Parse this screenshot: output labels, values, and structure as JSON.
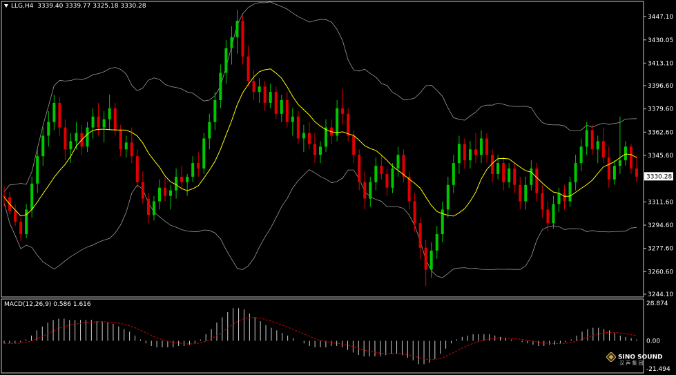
{
  "header": {
    "symbol": "LLG,H4",
    "ohlc": "3339.40 3339.77 3325.18 3330.28"
  },
  "macd_header": {
    "label": "MACD(12,26,9)",
    "values": "0.586 1.616"
  },
  "logo": {
    "name": "SINO SOUND",
    "sub": "汉 声 集 团"
  },
  "colors": {
    "background": "#000000",
    "bull": "#00c800",
    "bear": "#e00000",
    "ma": "#ffff00",
    "bands": "#9a9a9a",
    "macd_hist": "#d0d0d0",
    "macd_signal": "#e00000",
    "axis_text": "#ffffff",
    "price_label_bg": "#ffffff"
  },
  "chart_data": {
    "type": "candlestick",
    "price_axis": {
      "ticks": [
        "3447.10",
        "3430.05",
        "3413.10",
        "3396.60",
        "3379.60",
        "3362.60",
        "3345.60",
        "3330.28",
        "3311.60",
        "3294.60",
        "3277.60",
        "3260.60",
        "3244.10"
      ],
      "ylim": [
        3244.1,
        3447.1
      ],
      "current_price": "3330.28"
    },
    "macd_axis": {
      "ticks": [
        "28.874",
        "0.00",
        "-21.494"
      ],
      "ylim": [
        -21.494,
        28.874
      ]
    },
    "indicators": [
      "Moving Average",
      "Bollinger Bands",
      "MACD(12,26,9)"
    ],
    "candles": [
      [
        3316,
        3323,
        3308,
        3315
      ],
      [
        3315,
        3319,
        3302,
        3305
      ],
      [
        3305,
        3310,
        3294,
        3297
      ],
      [
        3297,
        3300,
        3283,
        3288
      ],
      [
        3288,
        3310,
        3285,
        3306
      ],
      [
        3306,
        3330,
        3300,
        3325
      ],
      [
        3325,
        3350,
        3318,
        3345
      ],
      [
        3345,
        3366,
        3338,
        3360
      ],
      [
        3360,
        3378,
        3352,
        3370
      ],
      [
        3370,
        3390,
        3364,
        3384
      ],
      [
        3384,
        3388,
        3360,
        3366
      ],
      [
        3366,
        3372,
        3342,
        3350
      ],
      [
        3350,
        3362,
        3340,
        3356
      ],
      [
        3356,
        3370,
        3350,
        3362
      ],
      [
        3362,
        3368,
        3346,
        3352
      ],
      [
        3352,
        3370,
        3348,
        3366
      ],
      [
        3366,
        3380,
        3358,
        3374
      ],
      [
        3374,
        3384,
        3360,
        3366
      ],
      [
        3366,
        3378,
        3355,
        3372
      ],
      [
        3372,
        3390,
        3364,
        3380
      ],
      [
        3380,
        3384,
        3360,
        3364
      ],
      [
        3364,
        3368,
        3345,
        3350
      ],
      [
        3350,
        3360,
        3344,
        3355
      ],
      [
        3355,
        3366,
        3340,
        3345
      ],
      [
        3345,
        3350,
        3322,
        3326
      ],
      [
        3326,
        3334,
        3310,
        3314
      ],
      [
        3314,
        3318,
        3296,
        3302
      ],
      [
        3302,
        3316,
        3298,
        3312
      ],
      [
        3312,
        3328,
        3306,
        3322
      ],
      [
        3322,
        3330,
        3312,
        3316
      ],
      [
        3316,
        3324,
        3306,
        3320
      ],
      [
        3320,
        3336,
        3314,
        3330
      ],
      [
        3330,
        3338,
        3320,
        3326
      ],
      [
        3326,
        3332,
        3316,
        3330
      ],
      [
        3330,
        3345,
        3326,
        3340
      ],
      [
        3340,
        3348,
        3330,
        3336
      ],
      [
        3336,
        3362,
        3332,
        3358
      ],
      [
        3358,
        3376,
        3350,
        3370
      ],
      [
        3370,
        3392,
        3364,
        3386
      ],
      [
        3386,
        3412,
        3380,
        3406
      ],
      [
        3406,
        3430,
        3398,
        3424
      ],
      [
        3424,
        3440,
        3412,
        3432
      ],
      [
        3432,
        3452,
        3420,
        3444
      ],
      [
        3444,
        3448,
        3412,
        3418
      ],
      [
        3418,
        3426,
        3396,
        3400
      ],
      [
        3400,
        3408,
        3386,
        3392
      ],
      [
        3392,
        3402,
        3384,
        3396
      ],
      [
        3396,
        3400,
        3378,
        3384
      ],
      [
        3384,
        3398,
        3380,
        3392
      ],
      [
        3392,
        3396,
        3372,
        3376
      ],
      [
        3376,
        3390,
        3370,
        3386
      ],
      [
        3386,
        3392,
        3366,
        3370
      ],
      [
        3370,
        3380,
        3360,
        3374
      ],
      [
        3374,
        3378,
        3354,
        3358
      ],
      [
        3358,
        3368,
        3348,
        3362
      ],
      [
        3362,
        3370,
        3350,
        3354
      ],
      [
        3354,
        3362,
        3340,
        3346
      ],
      [
        3346,
        3356,
        3340,
        3352
      ],
      [
        3352,
        3372,
        3348,
        3366
      ],
      [
        3366,
        3372,
        3354,
        3360
      ],
      [
        3360,
        3386,
        3356,
        3380
      ],
      [
        3380,
        3394,
        3368,
        3376
      ],
      [
        3376,
        3380,
        3356,
        3360
      ],
      [
        3360,
        3364,
        3340,
        3346
      ],
      [
        3346,
        3350,
        3320,
        3326
      ],
      [
        3326,
        3334,
        3306,
        3314
      ],
      [
        3314,
        3330,
        3308,
        3326
      ],
      [
        3326,
        3344,
        3320,
        3338
      ],
      [
        3338,
        3346,
        3328,
        3332
      ],
      [
        3332,
        3336,
        3316,
        3322
      ],
      [
        3322,
        3340,
        3318,
        3336
      ],
      [
        3336,
        3352,
        3330,
        3346
      ],
      [
        3346,
        3350,
        3326,
        3330
      ],
      [
        3330,
        3334,
        3306,
        3312
      ],
      [
        3312,
        3318,
        3290,
        3296
      ],
      [
        3296,
        3300,
        3270,
        3278
      ],
      [
        3278,
        3284,
        3250,
        3262
      ],
      [
        3262,
        3282,
        3256,
        3276
      ],
      [
        3276,
        3294,
        3270,
        3288
      ],
      [
        3288,
        3312,
        3282,
        3306
      ],
      [
        3306,
        3330,
        3300,
        3324
      ],
      [
        3324,
        3346,
        3318,
        3340
      ],
      [
        3340,
        3360,
        3332,
        3354
      ],
      [
        3354,
        3358,
        3336,
        3342
      ],
      [
        3342,
        3356,
        3336,
        3350
      ],
      [
        3350,
        3362,
        3340,
        3346
      ],
      [
        3346,
        3364,
        3340,
        3358
      ],
      [
        3358,
        3362,
        3340,
        3346
      ],
      [
        3346,
        3350,
        3326,
        3332
      ],
      [
        3332,
        3346,
        3328,
        3340
      ],
      [
        3340,
        3344,
        3320,
        3326
      ],
      [
        3326,
        3340,
        3322,
        3336
      ],
      [
        3336,
        3340,
        3318,
        3324
      ],
      [
        3324,
        3330,
        3306,
        3312
      ],
      [
        3312,
        3330,
        3306,
        3324
      ],
      [
        3324,
        3342,
        3320,
        3336
      ],
      [
        3336,
        3340,
        3312,
        3318
      ],
      [
        3318,
        3324,
        3300,
        3306
      ],
      [
        3306,
        3312,
        3290,
        3296
      ],
      [
        3296,
        3316,
        3292,
        3310
      ],
      [
        3310,
        3322,
        3304,
        3318
      ],
      [
        3318,
        3324,
        3306,
        3312
      ],
      [
        3312,
        3330,
        3308,
        3326
      ],
      [
        3326,
        3346,
        3320,
        3340
      ],
      [
        3340,
        3358,
        3334,
        3352
      ],
      [
        3352,
        3370,
        3346,
        3364
      ],
      [
        3364,
        3368,
        3346,
        3350
      ],
      [
        3350,
        3360,
        3340,
        3356
      ],
      [
        3356,
        3366,
        3340,
        3344
      ],
      [
        3344,
        3352,
        3322,
        3328
      ],
      [
        3328,
        3342,
        3324,
        3338
      ],
      [
        3338,
        3374,
        3332,
        3342
      ],
      [
        3342,
        3356,
        3338,
        3352
      ],
      [
        3352,
        3354,
        3332,
        3336
      ],
      [
        3336,
        3346,
        3326,
        3330
      ]
    ],
    "macd_histogram": [
      -2,
      -2,
      -2,
      -1,
      1,
      4,
      8,
      11,
      14,
      16,
      17,
      17,
      16,
      16,
      16,
      16,
      16,
      15,
      15,
      14,
      13,
      11,
      9,
      7,
      4,
      1,
      -2,
      -4,
      -5,
      -5,
      -5,
      -5,
      -4,
      -4,
      -3,
      -2,
      1,
      5,
      9,
      14,
      18,
      22,
      25,
      25,
      24,
      21,
      18,
      15,
      12,
      10,
      8,
      6,
      4,
      2,
      0,
      -2,
      -4,
      -5,
      -5,
      -5,
      -4,
      -4,
      -5,
      -7,
      -9,
      -11,
      -12,
      -12,
      -12,
      -12,
      -11,
      -10,
      -10,
      -11,
      -13,
      -15,
      -18,
      -18,
      -17,
      -14,
      -10,
      -6,
      -2,
      1,
      3,
      4,
      5,
      5,
      5,
      5,
      4,
      3,
      2,
      1,
      0,
      -1,
      -2,
      -3,
      -4,
      -4,
      -3,
      -3,
      -2,
      -1,
      1,
      4,
      7,
      9,
      10,
      10,
      9,
      8,
      6,
      4,
      3,
      2,
      1
    ],
    "macd_signal_note": "signal line drawn as dashed red"
  }
}
